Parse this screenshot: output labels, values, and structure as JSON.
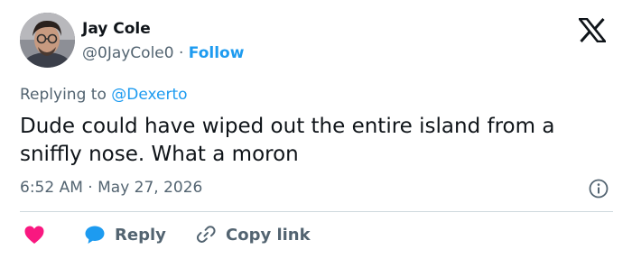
{
  "author": {
    "name": "Jay Cole",
    "handle": "@0JayCole0",
    "separator": "·",
    "follow_label": "Follow"
  },
  "reply_context": {
    "prefix": "Replying to",
    "mention": "@Dexerto"
  },
  "tweet": {
    "text": "Dude could have wiped out the entire island from a sniffly nose. What a moron",
    "time": "6:52 AM",
    "separator": "·",
    "date": "May 27, 2026"
  },
  "actions": {
    "reply_label": "Reply",
    "copy_link_label": "Copy link"
  },
  "colors": {
    "accent": "#1d9bf0",
    "like": "#f91880",
    "secondary_text": "#536471",
    "primary_text": "#0f1419"
  },
  "icons": [
    "x-logo-icon",
    "info-icon",
    "heart-icon",
    "reply-bubble-icon",
    "link-icon"
  ]
}
